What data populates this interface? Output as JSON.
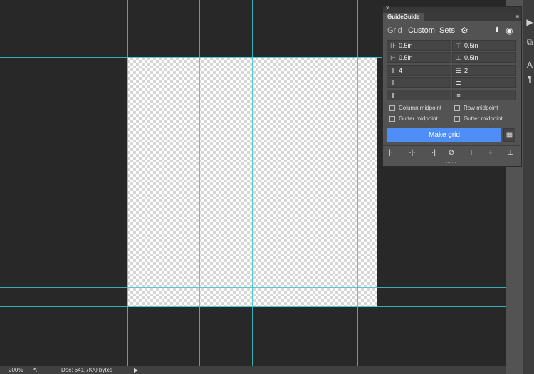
{
  "statusbar": {
    "zoom": "200%",
    "doc": "Doc: 641.7K/0 bytes"
  },
  "panel": {
    "tab_title": "GuideGuide",
    "nav": [
      "Grid",
      "Custom",
      "Sets"
    ],
    "fields": {
      "left_margin": "0.5in",
      "top_margin": "0.5in",
      "right_margin": "0.5in",
      "bottom_margin": "0.5in",
      "columns": "4",
      "rows": "2",
      "column_width": "",
      "row_height": "",
      "column_gutter": "",
      "row_gutter": ""
    },
    "checkboxes": {
      "column_midpoint": "Column midpoint",
      "row_midpoint": "Row midpoint",
      "gutter_midpoint_col": "Gutter midpoint",
      "gutter_midpoint_row": "Gutter midpoint"
    },
    "make_button": "Make grid",
    "colors": {
      "accent": "#4f8ef7",
      "guide": "#37c6d0",
      "panel_bg": "#535353"
    }
  },
  "icons": [
    "settings-gear-icon",
    "upload-arrow-icon",
    "visibility-eye-icon",
    "close-icon",
    "panel-menu-icon"
  ]
}
